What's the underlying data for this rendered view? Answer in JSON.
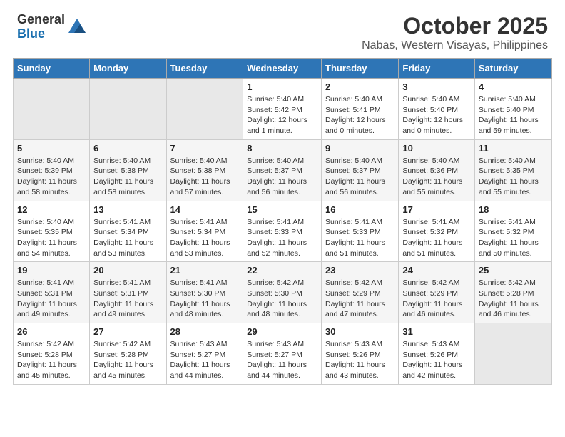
{
  "header": {
    "logo_general": "General",
    "logo_blue": "Blue",
    "month": "October 2025",
    "location": "Nabas, Western Visayas, Philippines"
  },
  "days_of_week": [
    "Sunday",
    "Monday",
    "Tuesday",
    "Wednesday",
    "Thursday",
    "Friday",
    "Saturday"
  ],
  "weeks": [
    [
      {
        "day": "",
        "info": ""
      },
      {
        "day": "",
        "info": ""
      },
      {
        "day": "",
        "info": ""
      },
      {
        "day": "1",
        "info": "Sunrise: 5:40 AM\nSunset: 5:42 PM\nDaylight: 12 hours\nand 1 minute."
      },
      {
        "day": "2",
        "info": "Sunrise: 5:40 AM\nSunset: 5:41 PM\nDaylight: 12 hours\nand 0 minutes."
      },
      {
        "day": "3",
        "info": "Sunrise: 5:40 AM\nSunset: 5:40 PM\nDaylight: 12 hours\nand 0 minutes."
      },
      {
        "day": "4",
        "info": "Sunrise: 5:40 AM\nSunset: 5:40 PM\nDaylight: 11 hours\nand 59 minutes."
      }
    ],
    [
      {
        "day": "5",
        "info": "Sunrise: 5:40 AM\nSunset: 5:39 PM\nDaylight: 11 hours\nand 58 minutes."
      },
      {
        "day": "6",
        "info": "Sunrise: 5:40 AM\nSunset: 5:38 PM\nDaylight: 11 hours\nand 58 minutes."
      },
      {
        "day": "7",
        "info": "Sunrise: 5:40 AM\nSunset: 5:38 PM\nDaylight: 11 hours\nand 57 minutes."
      },
      {
        "day": "8",
        "info": "Sunrise: 5:40 AM\nSunset: 5:37 PM\nDaylight: 11 hours\nand 56 minutes."
      },
      {
        "day": "9",
        "info": "Sunrise: 5:40 AM\nSunset: 5:37 PM\nDaylight: 11 hours\nand 56 minutes."
      },
      {
        "day": "10",
        "info": "Sunrise: 5:40 AM\nSunset: 5:36 PM\nDaylight: 11 hours\nand 55 minutes."
      },
      {
        "day": "11",
        "info": "Sunrise: 5:40 AM\nSunset: 5:35 PM\nDaylight: 11 hours\nand 55 minutes."
      }
    ],
    [
      {
        "day": "12",
        "info": "Sunrise: 5:40 AM\nSunset: 5:35 PM\nDaylight: 11 hours\nand 54 minutes."
      },
      {
        "day": "13",
        "info": "Sunrise: 5:41 AM\nSunset: 5:34 PM\nDaylight: 11 hours\nand 53 minutes."
      },
      {
        "day": "14",
        "info": "Sunrise: 5:41 AM\nSunset: 5:34 PM\nDaylight: 11 hours\nand 53 minutes."
      },
      {
        "day": "15",
        "info": "Sunrise: 5:41 AM\nSunset: 5:33 PM\nDaylight: 11 hours\nand 52 minutes."
      },
      {
        "day": "16",
        "info": "Sunrise: 5:41 AM\nSunset: 5:33 PM\nDaylight: 11 hours\nand 51 minutes."
      },
      {
        "day": "17",
        "info": "Sunrise: 5:41 AM\nSunset: 5:32 PM\nDaylight: 11 hours\nand 51 minutes."
      },
      {
        "day": "18",
        "info": "Sunrise: 5:41 AM\nSunset: 5:32 PM\nDaylight: 11 hours\nand 50 minutes."
      }
    ],
    [
      {
        "day": "19",
        "info": "Sunrise: 5:41 AM\nSunset: 5:31 PM\nDaylight: 11 hours\nand 49 minutes."
      },
      {
        "day": "20",
        "info": "Sunrise: 5:41 AM\nSunset: 5:31 PM\nDaylight: 11 hours\nand 49 minutes."
      },
      {
        "day": "21",
        "info": "Sunrise: 5:41 AM\nSunset: 5:30 PM\nDaylight: 11 hours\nand 48 minutes."
      },
      {
        "day": "22",
        "info": "Sunrise: 5:42 AM\nSunset: 5:30 PM\nDaylight: 11 hours\nand 48 minutes."
      },
      {
        "day": "23",
        "info": "Sunrise: 5:42 AM\nSunset: 5:29 PM\nDaylight: 11 hours\nand 47 minutes."
      },
      {
        "day": "24",
        "info": "Sunrise: 5:42 AM\nSunset: 5:29 PM\nDaylight: 11 hours\nand 46 minutes."
      },
      {
        "day": "25",
        "info": "Sunrise: 5:42 AM\nSunset: 5:28 PM\nDaylight: 11 hours\nand 46 minutes."
      }
    ],
    [
      {
        "day": "26",
        "info": "Sunrise: 5:42 AM\nSunset: 5:28 PM\nDaylight: 11 hours\nand 45 minutes."
      },
      {
        "day": "27",
        "info": "Sunrise: 5:42 AM\nSunset: 5:28 PM\nDaylight: 11 hours\nand 45 minutes."
      },
      {
        "day": "28",
        "info": "Sunrise: 5:43 AM\nSunset: 5:27 PM\nDaylight: 11 hours\nand 44 minutes."
      },
      {
        "day": "29",
        "info": "Sunrise: 5:43 AM\nSunset: 5:27 PM\nDaylight: 11 hours\nand 44 minutes."
      },
      {
        "day": "30",
        "info": "Sunrise: 5:43 AM\nSunset: 5:26 PM\nDaylight: 11 hours\nand 43 minutes."
      },
      {
        "day": "31",
        "info": "Sunrise: 5:43 AM\nSunset: 5:26 PM\nDaylight: 11 hours\nand 42 minutes."
      },
      {
        "day": "",
        "info": ""
      }
    ]
  ]
}
